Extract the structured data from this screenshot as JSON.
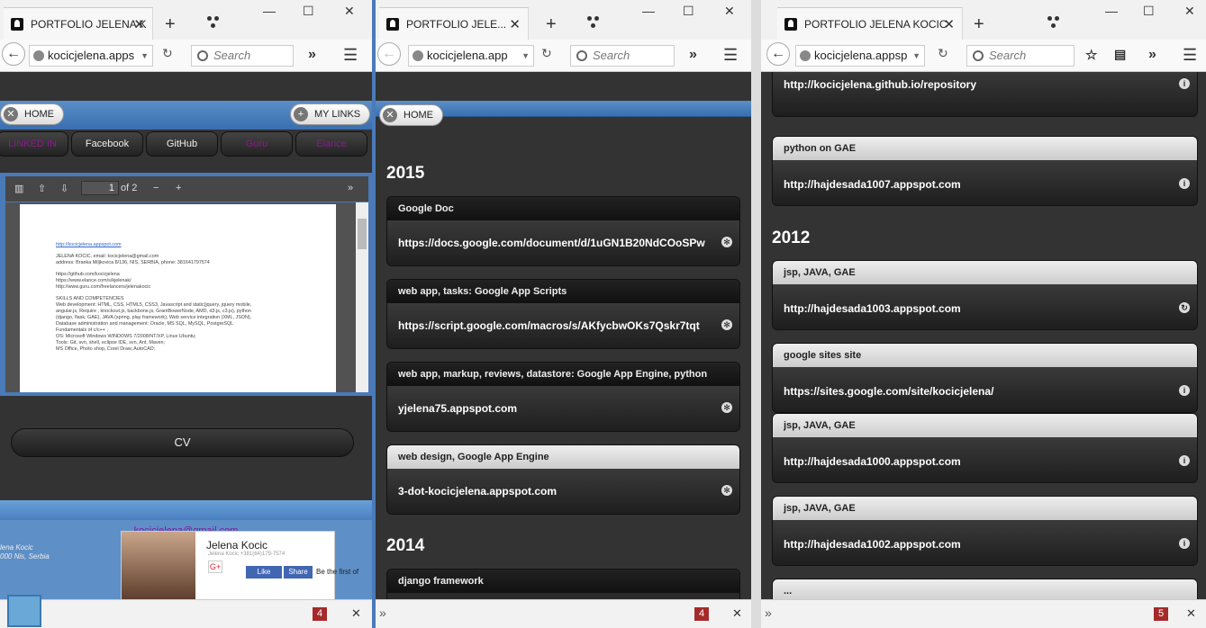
{
  "window1": {
    "tab_title": "PORTFOLIO JELENA K",
    "url": "kocicjelena.apps",
    "search_placeholder": "Search",
    "home_label": "HOME",
    "mylinks_label": "MY LINKS",
    "links": [
      "LINKED IN",
      "Facebook",
      "GitHub",
      "Guru",
      "Elance"
    ],
    "pdf": {
      "page_current": "1",
      "page_total": "of 2",
      "lines": [
        "http://kocicjelena.appspot.com",
        "",
        "JELENA KOCIC, email: kocicjelena@gmail.com",
        "address: Branka Miljkovica 8/136, NIS, SERBIA, phone: 381641797574",
        "",
        "https://github.com/kocicjelena",
        "https://www.elance.com/s/kjelenak/",
        "http://www.guru.com/freelancers/jelenakocic",
        "",
        "SKILLS AND COMPETENCIES",
        "Web development: HTML, CSS, HTML5, CSS3, Javascript and static(jquery, jquery mobile,",
        "angular.js, Require , knockout.js, backbone.js, GrantBowerNode, AMD, d3.js, c3.js), python",
        "(django, flask, GAE), JAVA (spring, play framework), Web service integration (XML, JSON),",
        "Database administration and management: Oracle, MS SQL, MySQL, PostgreSQL",
        "Fundamentals of c/c++ ;",
        "OS: Microsoft Windows WINDOWS 7/2008/NT/XP, Linux Ubuntu;",
        "Tools: Git, svn, shell, eclipse IDE, svn, Ant, Maven;",
        "MS Office, Photo shop, Corel Draw, AutoCAD;"
      ]
    },
    "cv_label": "CV",
    "email": "kocicjelena@gmail.com",
    "address": [
      "lena Kocic",
      "000 Nis, Serbia"
    ],
    "card_name": "Jelena Kocic",
    "card_phone": "Jelena Kocic +381(64)179-7574",
    "fb_like": "Like",
    "fb_share": "Share",
    "fb_text": "Be the first of",
    "status_count": "4"
  },
  "window2": {
    "tab_title": "PORTFOLIO JELE...",
    "url": "kocicjelena.app",
    "search_placeholder": "Search",
    "home_label": "HOME",
    "years": [
      "2015",
      "2014"
    ],
    "items": [
      {
        "title": "Google Doc",
        "value": "https://docs.google.com/document/d/1uGN1B20NdCOoSPw"
      },
      {
        "title": "web app, tasks: Google App Scripts",
        "value": "https://script.google.com/macros/s/AKfycbwOKs7Qskr7tqt"
      },
      {
        "title": "web app, markup, reviews, datastore: Google App Engine, python",
        "value": "yjelena75.appspot.com"
      },
      {
        "title": "web design, Google App Engine",
        "value": "3-dot-kocicjelena.appspot.com"
      },
      {
        "title": "django framework",
        "value": ""
      }
    ],
    "status_count": "4"
  },
  "window3": {
    "tab_title": "PORTFOLIO JELENA KOCIC",
    "url": "kocicjelena.appsp",
    "search_placeholder": "Search",
    "year": "2012",
    "top_value": "http://kocicjelena.github.io/repository",
    "items": [
      {
        "title": "python on GAE",
        "value": "http://hajdesada1007.appspot.com"
      },
      {
        "title": "jsp, JAVA, GAE",
        "value": "http://hajdesada1003.appspot.com"
      },
      {
        "title": "google sites site",
        "value": "https://sites.google.com/site/kocicjelena/"
      },
      {
        "title": "jsp, JAVA, GAE",
        "value": "http://hajdesada1000.appspot.com"
      },
      {
        "title": "jsp, JAVA, GAE",
        "value": "http://hajdesada1002.appspot.com"
      }
    ],
    "more": "...",
    "status_count": "5"
  }
}
